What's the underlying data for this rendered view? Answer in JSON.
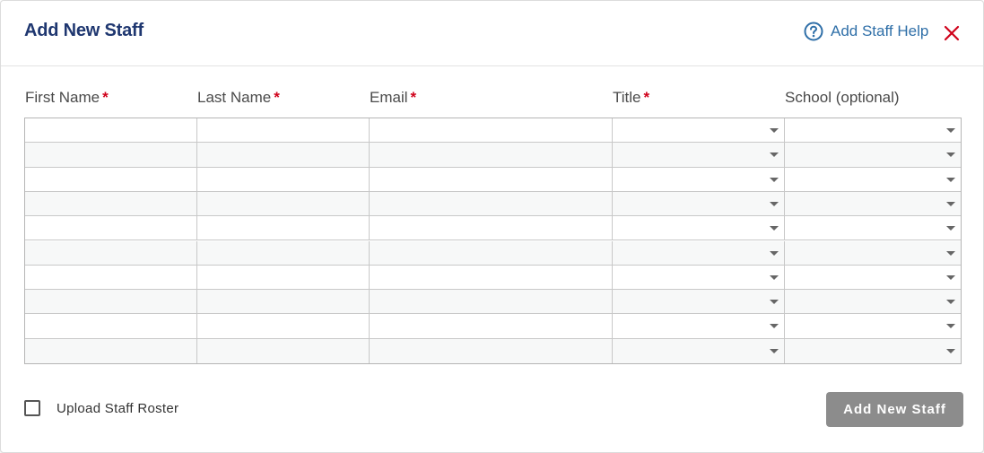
{
  "dialog": {
    "title": "Add New Staff",
    "help_label": "Add Staff Help",
    "icons": {
      "help": "question-circle-icon",
      "close": "close-x-icon"
    },
    "colors": {
      "title": "#1f3770",
      "link": "#2f6fa8",
      "required": "#d0021b",
      "close": "#d0021b",
      "button": "#8c8c8c"
    }
  },
  "columns": [
    {
      "label": "First Name",
      "required": "*"
    },
    {
      "label": "Last Name",
      "required": "*"
    },
    {
      "label": "Email",
      "required": "*"
    },
    {
      "label": "Title",
      "required": "*"
    },
    {
      "label": "School (optional)",
      "required": ""
    }
  ],
  "rows": [
    {
      "first_name": "",
      "last_name": "",
      "email": "",
      "title": "",
      "school": ""
    },
    {
      "first_name": "",
      "last_name": "",
      "email": "",
      "title": "",
      "school": ""
    },
    {
      "first_name": "",
      "last_name": "",
      "email": "",
      "title": "",
      "school": ""
    },
    {
      "first_name": "",
      "last_name": "",
      "email": "",
      "title": "",
      "school": ""
    },
    {
      "first_name": "",
      "last_name": "",
      "email": "",
      "title": "",
      "school": ""
    },
    {
      "first_name": "",
      "last_name": "",
      "email": "",
      "title": "",
      "school": ""
    },
    {
      "first_name": "",
      "last_name": "",
      "email": "",
      "title": "",
      "school": ""
    },
    {
      "first_name": "",
      "last_name": "",
      "email": "",
      "title": "",
      "school": ""
    },
    {
      "first_name": "",
      "last_name": "",
      "email": "",
      "title": "",
      "school": ""
    },
    {
      "first_name": "",
      "last_name": "",
      "email": "",
      "title": "",
      "school": ""
    }
  ],
  "footer": {
    "upload_label": "Upload Staff Roster",
    "upload_checked": false,
    "submit_label": "Add New Staff"
  }
}
